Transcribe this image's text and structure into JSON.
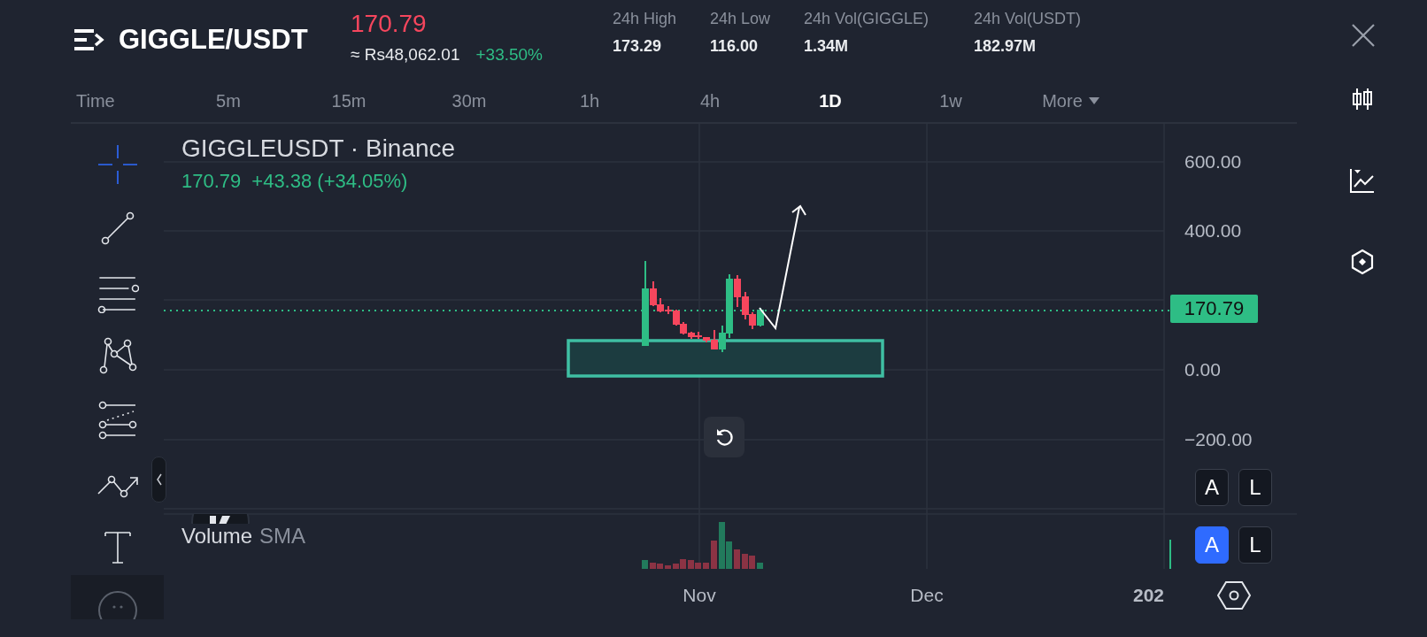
{
  "header": {
    "pair": "GIGGLE/USDT",
    "price": "170.79",
    "fiat_price": "≈ Rs48,062.01",
    "change": "+33.50%",
    "stats": [
      {
        "label": "24h High",
        "value": "173.29"
      },
      {
        "label": "24h Low",
        "value": "116.00"
      },
      {
        "label": "24h Vol(GIGGLE)",
        "value": "1.34M"
      },
      {
        "label": "24h Vol(USDT)",
        "value": "182.97M"
      }
    ]
  },
  "timeframes": [
    {
      "label": "Time",
      "selected": false,
      "dropdown": false
    },
    {
      "label": "5m",
      "selected": false,
      "dropdown": false
    },
    {
      "label": "15m",
      "selected": false,
      "dropdown": false
    },
    {
      "label": "30m",
      "selected": false,
      "dropdown": false
    },
    {
      "label": "1h",
      "selected": false,
      "dropdown": false
    },
    {
      "label": "4h",
      "selected": false,
      "dropdown": false
    },
    {
      "label": "1D",
      "selected": true,
      "dropdown": false
    },
    {
      "label": "1w",
      "selected": false,
      "dropdown": false
    },
    {
      "label": "More",
      "selected": false,
      "dropdown": true
    }
  ],
  "tools": [
    {
      "kind": "crosshair",
      "selected": true
    },
    {
      "kind": "trend-line",
      "selected": false
    },
    {
      "kind": "lines",
      "selected": false
    },
    {
      "kind": "pattern",
      "selected": false
    },
    {
      "kind": "fib",
      "selected": false
    },
    {
      "kind": "path",
      "selected": false
    },
    {
      "kind": "text",
      "selected": false
    }
  ],
  "chart": {
    "symbol": "GIGGLEUSDT · Binance",
    "last": "170.79",
    "change": "+43.38 (+34.05%)",
    "price_axis": [
      "600.00",
      "400.00",
      "0.00",
      "−200.00"
    ],
    "price_tag": "170.79",
    "date_axis": [
      "Nov",
      "Dec",
      "202"
    ],
    "volume_label": "Volume",
    "volume_indicator": "SMA"
  },
  "scale_rows": [
    {
      "buttons": [
        {
          "label": "A",
          "selected": false
        },
        {
          "label": "L",
          "selected": false
        }
      ]
    },
    {
      "buttons": [
        {
          "label": "A",
          "selected": true
        },
        {
          "label": "L",
          "selected": false
        }
      ]
    }
  ]
}
